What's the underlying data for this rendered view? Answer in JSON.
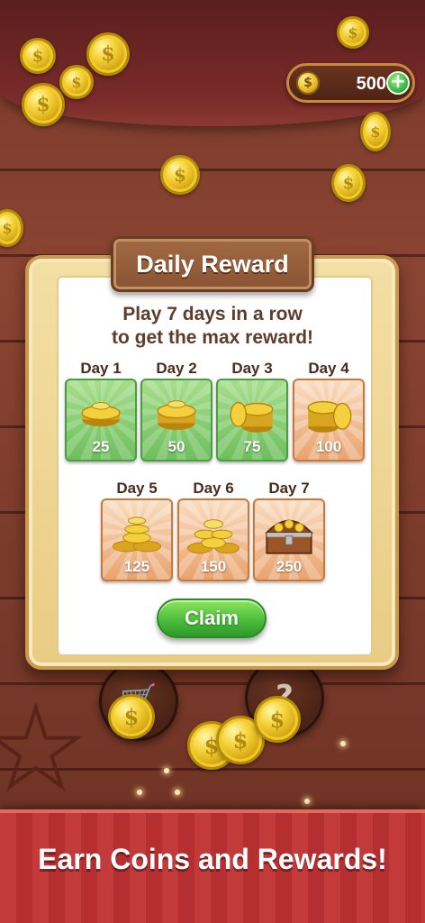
{
  "header": {
    "coin_balance": "500",
    "coin_icon": "$",
    "add_coins_icon": "+"
  },
  "dialog": {
    "title": "Daily Reward",
    "subtitle_line1": "Play 7 days in a row",
    "subtitle_line2": "to get the max reward!",
    "days": [
      {
        "label": "Day 1",
        "amount": "25",
        "status": "claimed",
        "art": "coin-stack-small"
      },
      {
        "label": "Day 2",
        "amount": "50",
        "status": "claimed",
        "art": "coin-stack-small"
      },
      {
        "label": "Day 3",
        "amount": "75",
        "status": "claimed",
        "art": "coin-stack-medium"
      },
      {
        "label": "Day 4",
        "amount": "100",
        "status": "current",
        "art": "coin-stack-medium"
      },
      {
        "label": "Day 5",
        "amount": "125",
        "status": "locked",
        "art": "coin-pile"
      },
      {
        "label": "Day 6",
        "amount": "150",
        "status": "locked",
        "art": "coin-pile-large"
      },
      {
        "label": "Day 7",
        "amount": "250",
        "status": "locked",
        "art": "treasure-chest"
      }
    ],
    "claim_label": "Claim"
  },
  "background": {
    "help_icon": "?"
  },
  "banner": {
    "text": "Earn Coins and Rewards!"
  },
  "colors": {
    "claimed_tile": "#6fbf5e",
    "locked_tile": "#eaa36d",
    "banner_red": "#c23a3a",
    "claim_green": "#48b83a"
  }
}
